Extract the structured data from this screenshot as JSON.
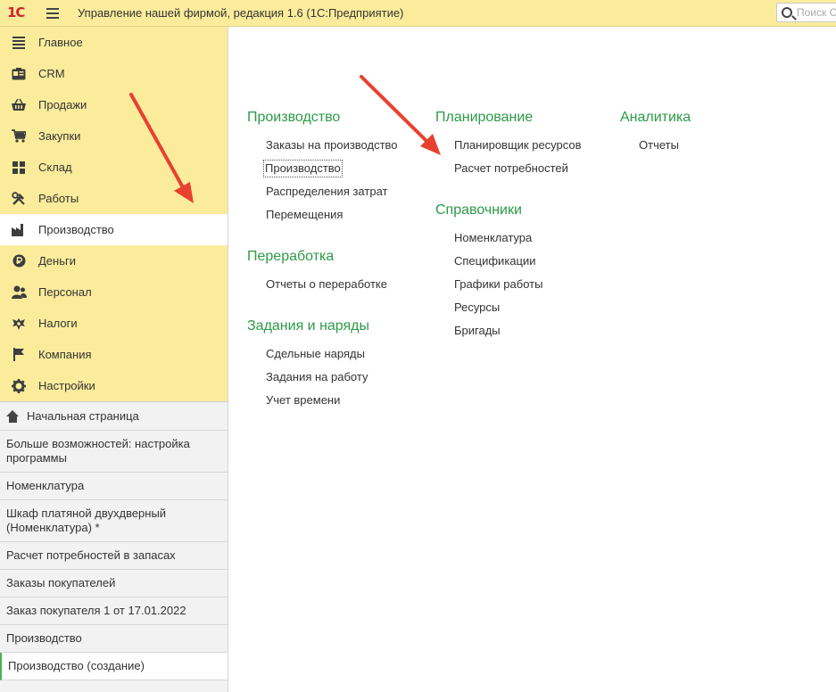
{
  "app": {
    "logo": "1С",
    "title": "Управление нашей фирмой, редакция 1.6  (1С:Предприятие)",
    "search_placeholder": "Поиск Ctrl+Shift+F"
  },
  "sidebar": {
    "items": [
      {
        "label": "Главное",
        "icon": "lines-icon"
      },
      {
        "label": "CRM",
        "icon": "crm-icon"
      },
      {
        "label": "Продажи",
        "icon": "basket-icon"
      },
      {
        "label": "Закупки",
        "icon": "cart-icon"
      },
      {
        "label": "Склад",
        "icon": "grid-icon"
      },
      {
        "label": "Работы",
        "icon": "tools-icon"
      },
      {
        "label": "Производство",
        "icon": "factory-icon"
      },
      {
        "label": "Деньги",
        "icon": "ruble-icon"
      },
      {
        "label": "Персонал",
        "icon": "people-icon"
      },
      {
        "label": "Налоги",
        "icon": "eagle-icon"
      },
      {
        "label": "Компания",
        "icon": "flag-icon"
      },
      {
        "label": "Настройки",
        "icon": "gear-icon"
      }
    ],
    "active_index": 6
  },
  "open_windows": [
    "Начальная страница",
    "Больше возможностей: настройка программы",
    "Номенклатура",
    "Шкаф платяной двухдверный (Номенклатура) *",
    "Расчет потребностей в запасах",
    "Заказы покупателей",
    "Заказ покупателя 1 от 17.01.2022",
    "Производство",
    "Производство (создание)"
  ],
  "sections": {
    "production": {
      "title": "Производство",
      "links": [
        "Заказы на производство",
        "Производство",
        "Распределения затрат",
        "Перемещения"
      ]
    },
    "processing": {
      "title": "Переработка",
      "links": [
        "Отчеты о переработке"
      ]
    },
    "tasks": {
      "title": "Задания и наряды",
      "links": [
        "Сдельные наряды",
        "Задания на работу",
        "Учет времени"
      ]
    },
    "planning": {
      "title": "Планирование",
      "links": [
        "Планировщик ресурсов",
        "Расчет потребностей"
      ]
    },
    "catalogs": {
      "title": "Справочники",
      "links": [
        "Номенклатура",
        "Спецификации",
        "Графики работы",
        "Ресурсы",
        "Бригады"
      ]
    },
    "analytics": {
      "title": "Аналитика",
      "links": [
        "Отчеты"
      ]
    }
  },
  "colors": {
    "sidebar_bg": "#fbec9c",
    "section_title": "#2c9a47",
    "arrow": "#e8412f"
  }
}
